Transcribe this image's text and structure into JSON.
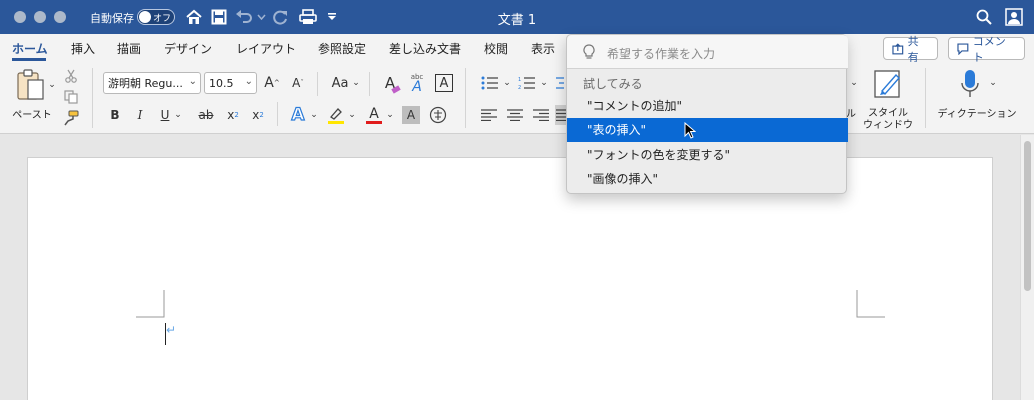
{
  "window": {
    "title": "文書 1",
    "autosave_label": "自動保存",
    "autosave_state": "オフ"
  },
  "tabs": [
    "ホーム",
    "挿入",
    "描画",
    "デザイン",
    "レイアウト",
    "参照設定",
    "差し込み文書",
    "校閲",
    "表示"
  ],
  "share_button": "共有",
  "comment_button": "コメント",
  "ribbon": {
    "paste_label": "ペースト",
    "font_name": "游明朝 Regu...",
    "font_size": "10.5",
    "styles_partial_label": "ル",
    "style_window_label_1": "スタイル",
    "style_window_label_2": "ウィンドウ",
    "dictation_label": "ディクテーション",
    "bold": "B",
    "italic": "I",
    "underline": "U",
    "strike": "ab",
    "subscript": "x",
    "superscript": "x",
    "sub_mark": "2",
    "sup_mark": "2",
    "grow_font": "A",
    "shrink_font": "A",
    "change_case": "Aa",
    "font_color_letter": "A",
    "shading_letter": "A",
    "text_effect_letter": "A",
    "clear_format_letter": "A",
    "phonetic_small": "abc",
    "phonetic_letter": "A",
    "char_border_letter": "A"
  },
  "tell_me": {
    "placeholder": "希望する作業を入力",
    "heading": "試してみる",
    "suggestions": [
      "\"コメントの追加\"",
      "\"表の挿入\"",
      "\"フォントの色を変更する\"",
      "\"画像の挿入\""
    ],
    "selected_index": 1
  },
  "colors": {
    "title_bar": "#2b579a",
    "selection": "#0a69d4",
    "highlight_yellow": "#ffe600",
    "font_red": "#e01b1b"
  }
}
